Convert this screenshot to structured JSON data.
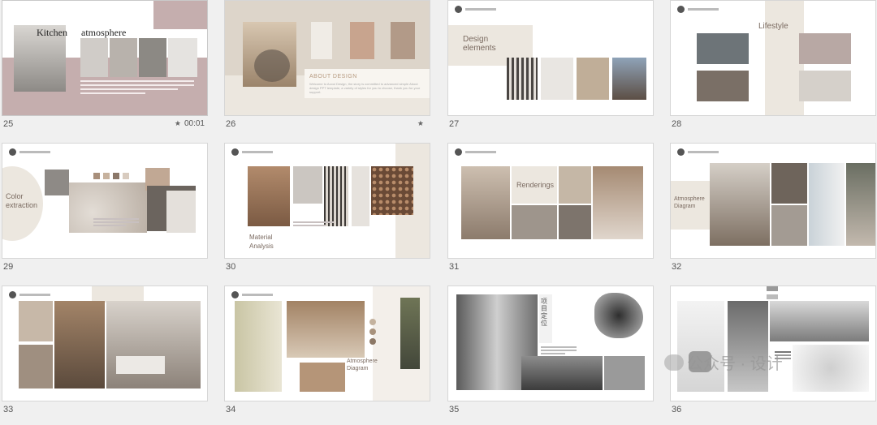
{
  "slides": [
    {
      "number": "25",
      "time": "00:01",
      "starred": true,
      "title_a": "Kitchen",
      "title_b": "atmosphere"
    },
    {
      "number": "26",
      "starred": true,
      "heading": "ABOUT DESIGN",
      "body": "Welcome to Aoxui Design, the story is committed to advanced simple About design PPT template, a variety of styles for you to choose, thank you for your support."
    },
    {
      "number": "27",
      "heading": "Design elements"
    },
    {
      "number": "28",
      "heading": "Lifestyle"
    },
    {
      "number": "29",
      "heading": "Color extraction"
    },
    {
      "number": "30",
      "heading": "Material Analysis"
    },
    {
      "number": "31",
      "heading": "Renderings"
    },
    {
      "number": "32",
      "heading": "Atmosphere Diagram"
    },
    {
      "number": "33"
    },
    {
      "number": "34",
      "heading": "Atmosphere Diagram"
    },
    {
      "number": "35",
      "vertical": "项目定位"
    },
    {
      "number": "36"
    }
  ],
  "watermark": "公众号 · 设计",
  "colors": {
    "mauve": "#c5aeae",
    "beige": "#ece7df",
    "tan": "#b69a80"
  }
}
